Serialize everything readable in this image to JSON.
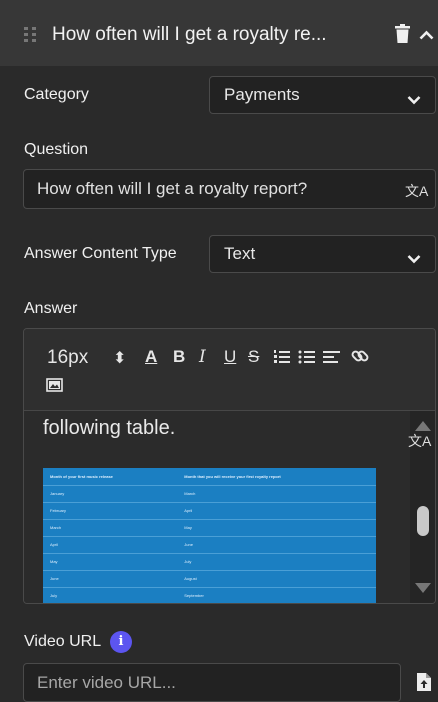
{
  "header": {
    "title": "How often will I get a royalty re..."
  },
  "category": {
    "label": "Category",
    "value": "Payments"
  },
  "question": {
    "label": "Question",
    "value": "How often will I get a royalty report?",
    "translate_glyph": "文A"
  },
  "answer_content_type": {
    "label": "Answer Content Type",
    "value": "Text"
  },
  "answer": {
    "label": "Answer",
    "toolbar": {
      "font_size": "16px",
      "stepper_glyph": "⬍",
      "font_color": "A",
      "bold": "B",
      "italic": "I",
      "underline": "U",
      "strike": "S"
    },
    "content_text": "following table.",
    "translate_glyph": "文A",
    "table": {
      "headers": [
        "Month of your first music release",
        "Month that you will receive your first royalty report"
      ],
      "rows": [
        [
          "January",
          "March"
        ],
        [
          "February",
          "April"
        ],
        [
          "March",
          "May"
        ],
        [
          "April",
          "June"
        ],
        [
          "May",
          "July"
        ],
        [
          "June",
          "August"
        ],
        [
          "July",
          "September"
        ]
      ]
    }
  },
  "video": {
    "label": "Video URL",
    "info_glyph": "i",
    "placeholder": "Enter video URL..."
  },
  "colors": {
    "background": "#2a2a2a",
    "header": "#373737",
    "info_accent": "#5c55f0",
    "table_blue": "#1b7fc2"
  }
}
